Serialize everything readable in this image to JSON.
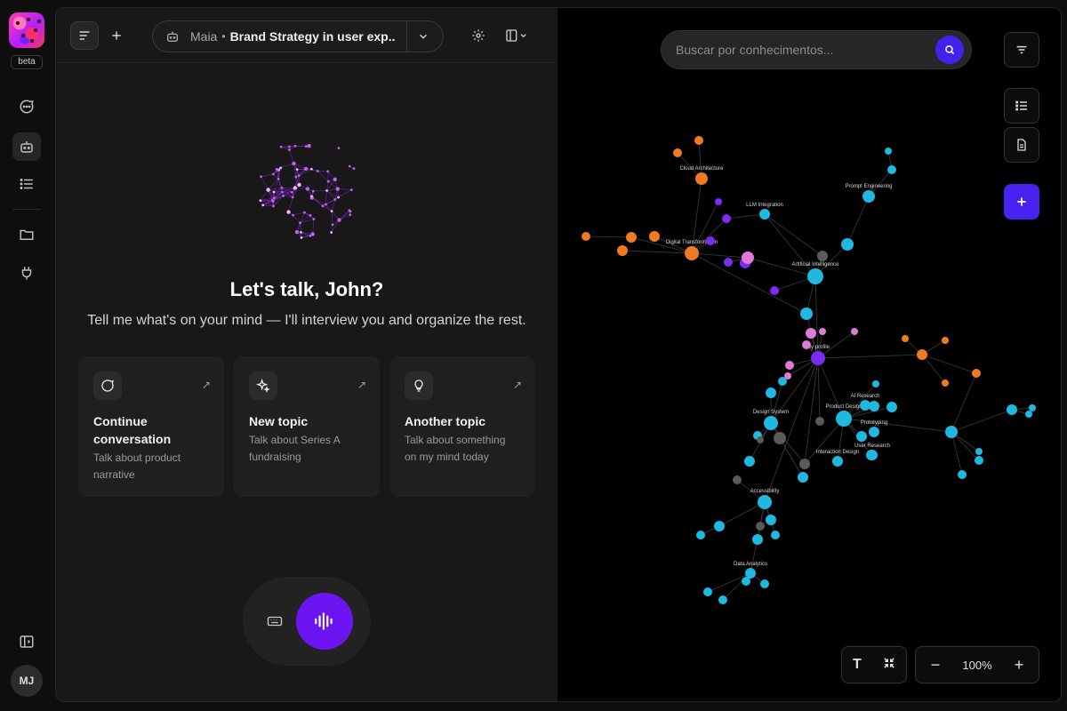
{
  "rail": {
    "beta_label": "beta",
    "items": [
      {
        "name": "chat-icon"
      },
      {
        "name": "bot-icon"
      },
      {
        "name": "list-icon"
      },
      {
        "name": "folder-icon"
      },
      {
        "name": "plug-icon"
      }
    ],
    "avatar_initials": "MJ"
  },
  "header": {
    "agent": "Maia",
    "separator": "•",
    "session_title": "Brand Strategy in user exp..."
  },
  "chat": {
    "greeting": "Let's talk, John?",
    "subtitle": "Tell me what's on your mind — I'll interview you and organize the rest.",
    "cards": [
      {
        "title": "Continue conversation",
        "desc": "Talk about product narrative",
        "icon": "message-icon"
      },
      {
        "title": "New topic",
        "desc": "Talk about Series A fundraising",
        "icon": "sparkles-icon"
      },
      {
        "title": "Another topic",
        "desc": "Talk about something on my mind today",
        "icon": "lightbulb-icon"
      }
    ]
  },
  "graph": {
    "search_placeholder": "Buscar por conhecimentos...",
    "zoom_level": "100%",
    "zoom_out": "−",
    "zoom_in": "+",
    "text_tool": "T",
    "colors": {
      "orange": "#f07a22",
      "blue": "#1fb8e0",
      "purple": "#7b2cf0",
      "pink": "#e07ad8",
      "gray": "#5a5a5a"
    },
    "labels": {
      "artificial_intelligence": "Artificial Intelligence",
      "my_profile": "My profile",
      "product_design": "Product Design",
      "design_system": "Design System",
      "digital_transformation": "Digital Transformation",
      "cloud_architecture": "Cloud Architecture",
      "llm_integration": "LLM Integration",
      "prompt_engineering": "Prompt Engineering",
      "accessibility": "Accessibility",
      "ai_research": "AI Research",
      "interaction_design": "Interaction Design",
      "data_analytics": "Data Analytics",
      "user_research": "User Research",
      "prototyping": "Prototyping"
    }
  }
}
